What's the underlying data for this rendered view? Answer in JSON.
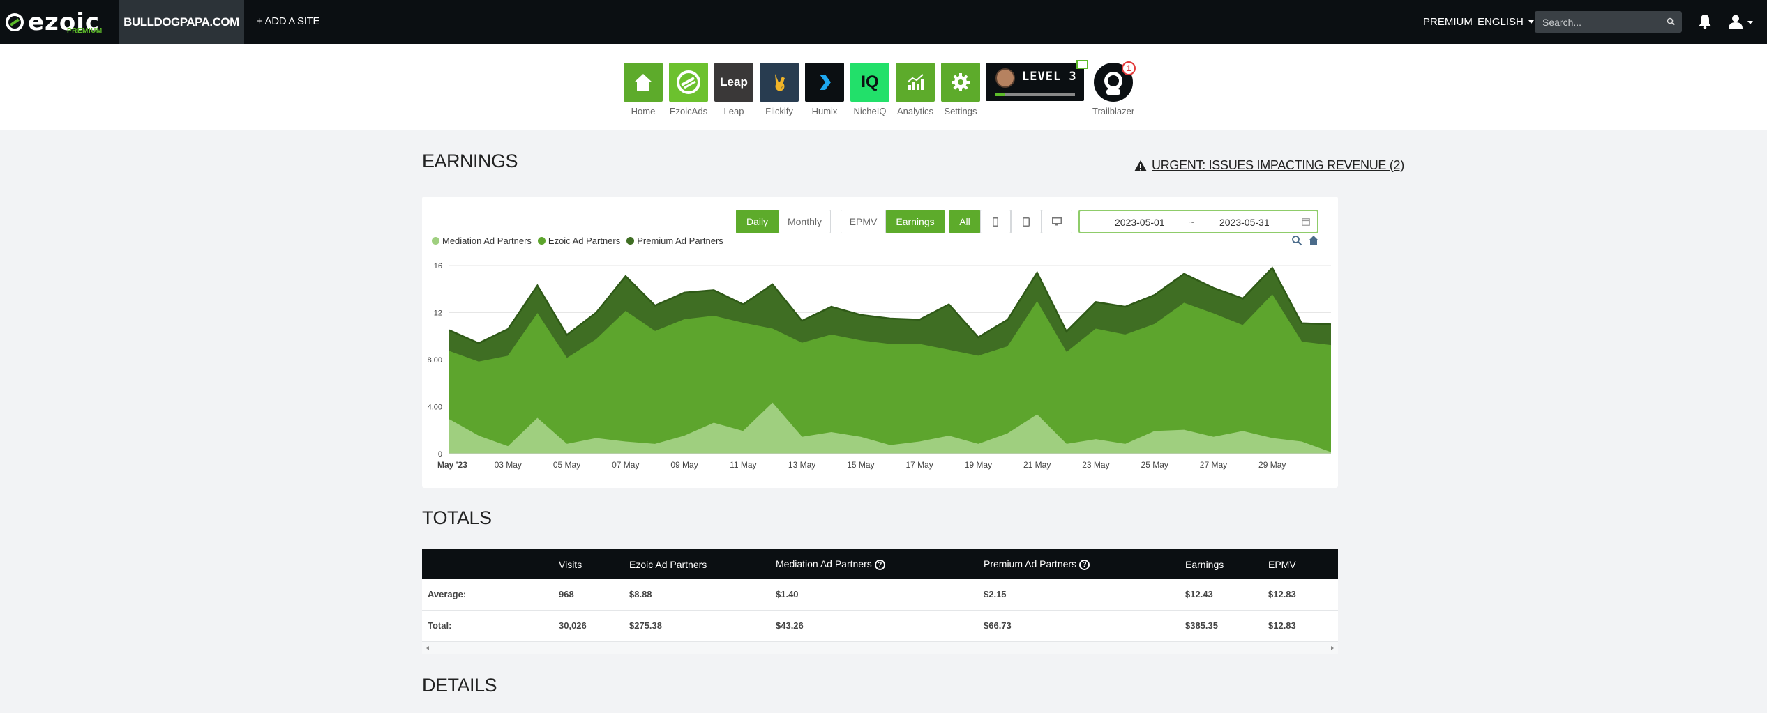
{
  "topbar": {
    "logo_text": "ezoic",
    "logo_sub": "PREMIUM",
    "site_name": "BULLDOGPAPA.COM",
    "add_site": "+ ADD A SITE",
    "premium": "PREMIUM",
    "language": "ENGLISH",
    "search_placeholder": "Search..."
  },
  "apps": [
    {
      "label": "Home",
      "color": "#5dab2b"
    },
    {
      "label": "EzoicAds",
      "color": "#6cc12e"
    },
    {
      "label": "Leap",
      "color": "#3a3838"
    },
    {
      "label": "Flickify",
      "color": "#283c50"
    },
    {
      "label": "Humix",
      "color": "#0b0f12"
    },
    {
      "label": "NicheIQ",
      "color": "#22e06a"
    },
    {
      "label": "Analytics",
      "color": "#5dab2b"
    },
    {
      "label": "Settings",
      "color": "#5dab2b"
    }
  ],
  "app_icon_text": {
    "leap": "Leap",
    "nicheiq": "IQ"
  },
  "level": {
    "text": "LEVEL 3",
    "progress": 0.12
  },
  "trailblazer": {
    "label": "Trailblazer",
    "badge": "1"
  },
  "earnings": {
    "title": "EARNINGS",
    "urgent": "URGENT: ISSUES IMPACTING REVENUE (2)",
    "buttons": {
      "daily": "Daily",
      "monthly": "Monthly",
      "epmv": "EPMV",
      "earnings": "Earnings",
      "all": "All"
    },
    "date_start": "2023-05-01",
    "date_sep": "~",
    "date_end": "2023-05-31"
  },
  "colors": {
    "mediation": "#9fcf7f",
    "ezoic": "#5da52d",
    "premium": "#3f6e23",
    "accent": "#5dab2b"
  },
  "chart_data": {
    "type": "area",
    "stacked": true,
    "ylim": [
      0,
      16
    ],
    "yticks": [
      "0",
      "4.00",
      "8.00",
      "12",
      "16"
    ],
    "x_tick_labels": [
      "May '23",
      "03 May",
      "05 May",
      "07 May",
      "09 May",
      "11 May",
      "13 May",
      "15 May",
      "17 May",
      "19 May",
      "21 May",
      "23 May",
      "25 May",
      "27 May",
      "29 May"
    ],
    "x": [
      "2023-05-01",
      "2023-05-02",
      "2023-05-03",
      "2023-05-04",
      "2023-05-05",
      "2023-05-06",
      "2023-05-07",
      "2023-05-08",
      "2023-05-09",
      "2023-05-10",
      "2023-05-11",
      "2023-05-12",
      "2023-05-13",
      "2023-05-14",
      "2023-05-15",
      "2023-05-16",
      "2023-05-17",
      "2023-05-18",
      "2023-05-19",
      "2023-05-20",
      "2023-05-21",
      "2023-05-22",
      "2023-05-23",
      "2023-05-24",
      "2023-05-25",
      "2023-05-26",
      "2023-05-27",
      "2023-05-28",
      "2023-05-29",
      "2023-05-30",
      "2023-05-31"
    ],
    "series": [
      {
        "name": "Mediation Ad Partners",
        "values": [
          2.9,
          1.5,
          0.6,
          3.0,
          0.8,
          1.3,
          1.0,
          0.8,
          1.5,
          2.6,
          1.9,
          4.3,
          1.4,
          1.8,
          1.4,
          0.7,
          1.0,
          1.5,
          0.8,
          1.7,
          3.3,
          0.8,
          1.2,
          0.8,
          1.9,
          2.0,
          1.4,
          1.9,
          1.3,
          1.0,
          0.1
        ]
      },
      {
        "name": "Ezoic Ad Partners",
        "values": [
          5.8,
          6.3,
          7.7,
          8.9,
          7.3,
          8.4,
          11.1,
          9.6,
          9.9,
          9.1,
          9.2,
          6.3,
          8.0,
          8.3,
          8.2,
          8.6,
          8.3,
          7.3,
          7.5,
          7.4,
          9.6,
          7.8,
          9.4,
          9.3,
          9.1,
          10.8,
          10.5,
          9.0,
          12.2,
          8.5,
          9.1
        ]
      },
      {
        "name": "Premium Ad Partners",
        "values": [
          1.8,
          1.6,
          2.3,
          2.4,
          2.0,
          2.3,
          3.0,
          2.2,
          2.3,
          2.2,
          1.6,
          3.8,
          1.9,
          2.4,
          2.2,
          2.2,
          2.1,
          3.9,
          1.6,
          2.3,
          2.5,
          1.8,
          2.3,
          2.4,
          2.5,
          2.5,
          2.2,
          2.3,
          2.3,
          1.6,
          1.8
        ]
      }
    ]
  },
  "totals": {
    "title": "TOTALS",
    "headers": [
      "",
      "Visits",
      "Ezoic Ad Partners",
      "Mediation Ad Partners",
      "Premium Ad Partners",
      "Earnings",
      "EPMV"
    ],
    "help_mark": "?",
    "rows": [
      [
        "Average:",
        "968",
        "$8.88",
        "$1.40",
        "$2.15",
        "$12.43",
        "$12.83"
      ],
      [
        "Total:",
        "30,026",
        "$275.38",
        "$43.26",
        "$66.73",
        "$385.35",
        "$12.83"
      ]
    ]
  },
  "details": {
    "title": "DETAILS"
  }
}
